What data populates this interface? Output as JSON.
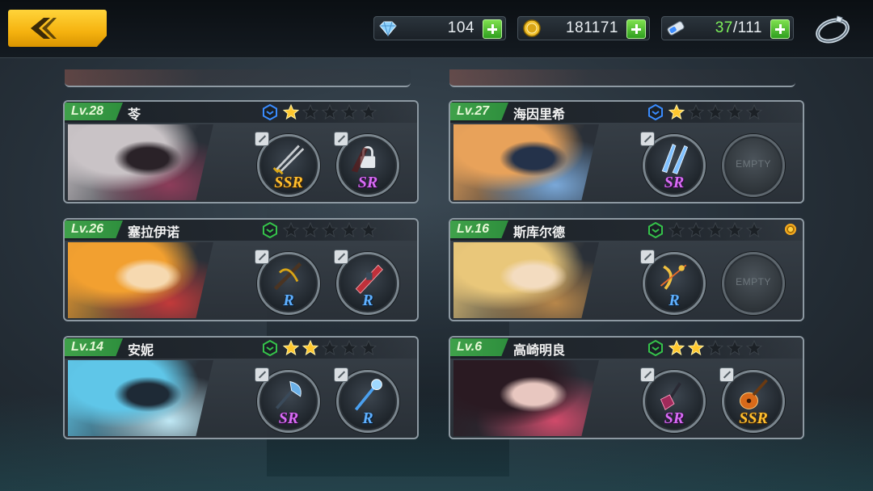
{
  "resources": {
    "crystals": {
      "icon": "crystal-icon",
      "value": "104"
    },
    "gold": {
      "icon": "gold-coin-icon",
      "value": "181171"
    },
    "stamina": {
      "icon": "stamina-battery-icon",
      "current": "37",
      "max": "/111"
    }
  },
  "characters": [
    {
      "level": "Lv.28",
      "name": "苓",
      "rank_color": "#3a8cff",
      "stars": 1,
      "max_stars": 5,
      "portrait_colors": [
        "#c9c3c6",
        "#2a2228",
        "#8d3d5a"
      ],
      "weapons": [
        {
          "rarity": "SSR",
          "icon": "twin-swords-icon",
          "locked": false
        },
        {
          "rarity": "SR",
          "icon": "lock-icon",
          "locked": true
        }
      ],
      "notify": false
    },
    {
      "level": "Lv.27",
      "name": "海因里希",
      "rank_color": "#3a8cff",
      "stars": 1,
      "max_stars": 5,
      "portrait_colors": [
        "#e8a25a",
        "#24324a",
        "#7aa8d8"
      ],
      "weapons": [
        {
          "rarity": "SR",
          "icon": "blue-blades-icon",
          "locked": false
        },
        {
          "rarity": "",
          "icon": "empty-slot-icon",
          "empty": true,
          "empty_label": "EMPTY"
        }
      ],
      "notify": false
    },
    {
      "level": "Lv.26",
      "name": "塞拉伊诺",
      "rank_color": "#35c24a",
      "stars": 0,
      "max_stars": 5,
      "portrait_colors": [
        "#f2a030",
        "#f6d9b0",
        "#c23a3a"
      ],
      "weapons": [
        {
          "rarity": "R",
          "icon": "crossbow-icon",
          "locked": false
        },
        {
          "rarity": "R",
          "icon": "red-launcher-icon",
          "locked": false
        }
      ],
      "notify": false
    },
    {
      "level": "Lv.16",
      "name": "斯库尔德",
      "rank_color": "#35c24a",
      "stars": 0,
      "max_stars": 5,
      "portrait_colors": [
        "#e9c77a",
        "#f3dcc0",
        "#b8874a"
      ],
      "weapons": [
        {
          "rarity": "R",
          "icon": "golden-bow-icon",
          "locked": false
        },
        {
          "rarity": "",
          "icon": "empty-slot-icon",
          "empty": true,
          "empty_label": "EMPTY"
        }
      ],
      "notify": true
    },
    {
      "level": "Lv.14",
      "name": "安妮",
      "rank_color": "#35c24a",
      "stars": 2,
      "max_stars": 5,
      "portrait_colors": [
        "#5fc6e8",
        "#1e2a36",
        "#bfe8f5"
      ],
      "weapons": [
        {
          "rarity": "SR",
          "icon": "axe-icon",
          "locked": false
        },
        {
          "rarity": "R",
          "icon": "blue-staff-icon",
          "locked": false
        }
      ],
      "notify": false
    },
    {
      "level": "Lv.6",
      "name": "高崎明良",
      "rank_color": "#35c24a",
      "stars": 2,
      "max_stars": 5,
      "portrait_colors": [
        "#2a1a22",
        "#e8c7c0",
        "#d04a6a"
      ],
      "weapons": [
        {
          "rarity": "SR",
          "icon": "electric-guitar-icon",
          "locked": false
        },
        {
          "rarity": "SSR",
          "icon": "acoustic-guitar-icon",
          "locked": false
        }
      ],
      "notify": false
    }
  ]
}
